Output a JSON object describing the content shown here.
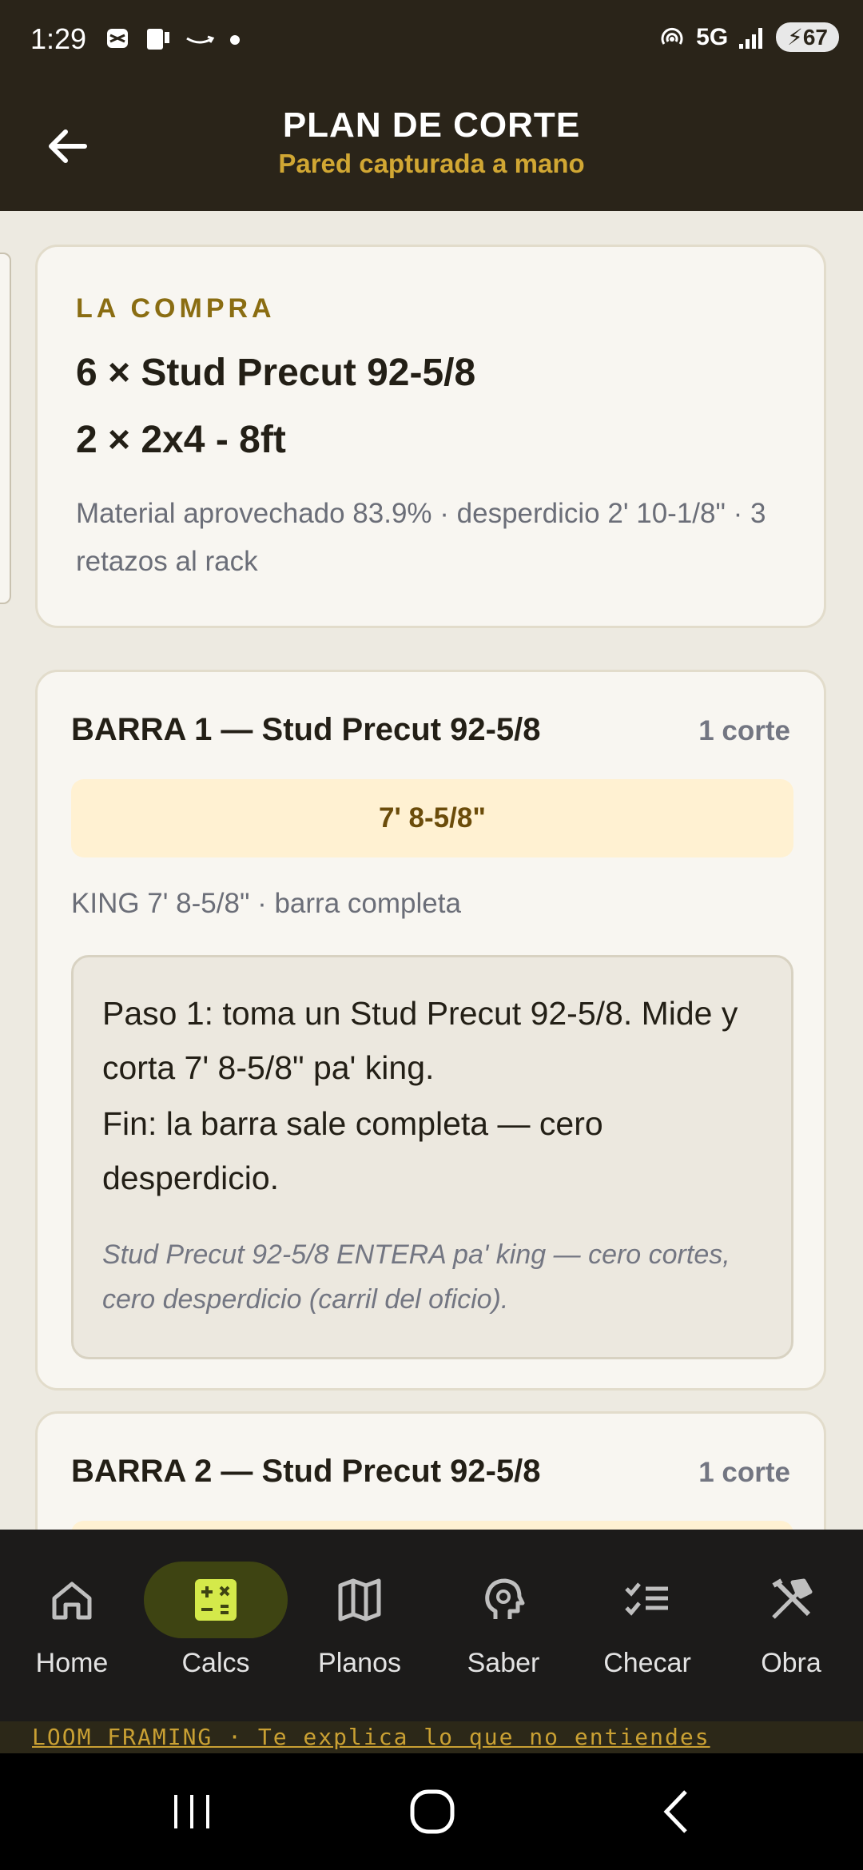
{
  "status_bar": {
    "time": "1:29",
    "network": "5G",
    "battery": "67"
  },
  "app_bar": {
    "title": "PLAN DE CORTE",
    "subtitle": "Pared capturada a mano"
  },
  "compra": {
    "label": "LA COMPRA",
    "items": [
      "6 × Stud Precut 92-5/8",
      "2 × 2x4 - 8ft"
    ],
    "note": "Material aprovechado 83.9% · desperdicio 2' 10-1/8\" · 3 retazos al rack"
  },
  "barras": [
    {
      "title": "BARRA 1 — Stud Precut 92-5/8",
      "count": "1 corte",
      "cut": "7' 8-5/8\"",
      "desc": "KING 7' 8-5/8\" · barra completa",
      "step": "Paso 1: toma un Stud Precut 92-5/8. Mide y corta 7' 8-5/8\" pa' king.",
      "fin": "Fin: la barra sale completa — cero desperdicio.",
      "note": "Stud Precut 92-5/8 ENTERA pa' king — cero cortes, cero desperdicio (carril del oficio)."
    },
    {
      "title": "BARRA 2 — Stud Precut 92-5/8",
      "count": "1 corte"
    }
  ],
  "nav": {
    "items": [
      {
        "label": "Home",
        "icon": "home-icon"
      },
      {
        "label": "Calcs",
        "icon": "calculator-icon",
        "active": true
      },
      {
        "label": "Planos",
        "icon": "map-icon"
      },
      {
        "label": "Saber",
        "icon": "brain-icon"
      },
      {
        "label": "Checar",
        "icon": "checklist-icon"
      },
      {
        "label": "Obra",
        "icon": "tools-icon"
      }
    ]
  },
  "banner": {
    "text": "LOOM FRAMING  ·  Te explica lo que no entiendes"
  },
  "colors": {
    "header_bg": "#2A2419",
    "accent_gold": "#D1A733",
    "active_nav_pill": "#3E4412",
    "active_icon": "#D4E94A"
  }
}
